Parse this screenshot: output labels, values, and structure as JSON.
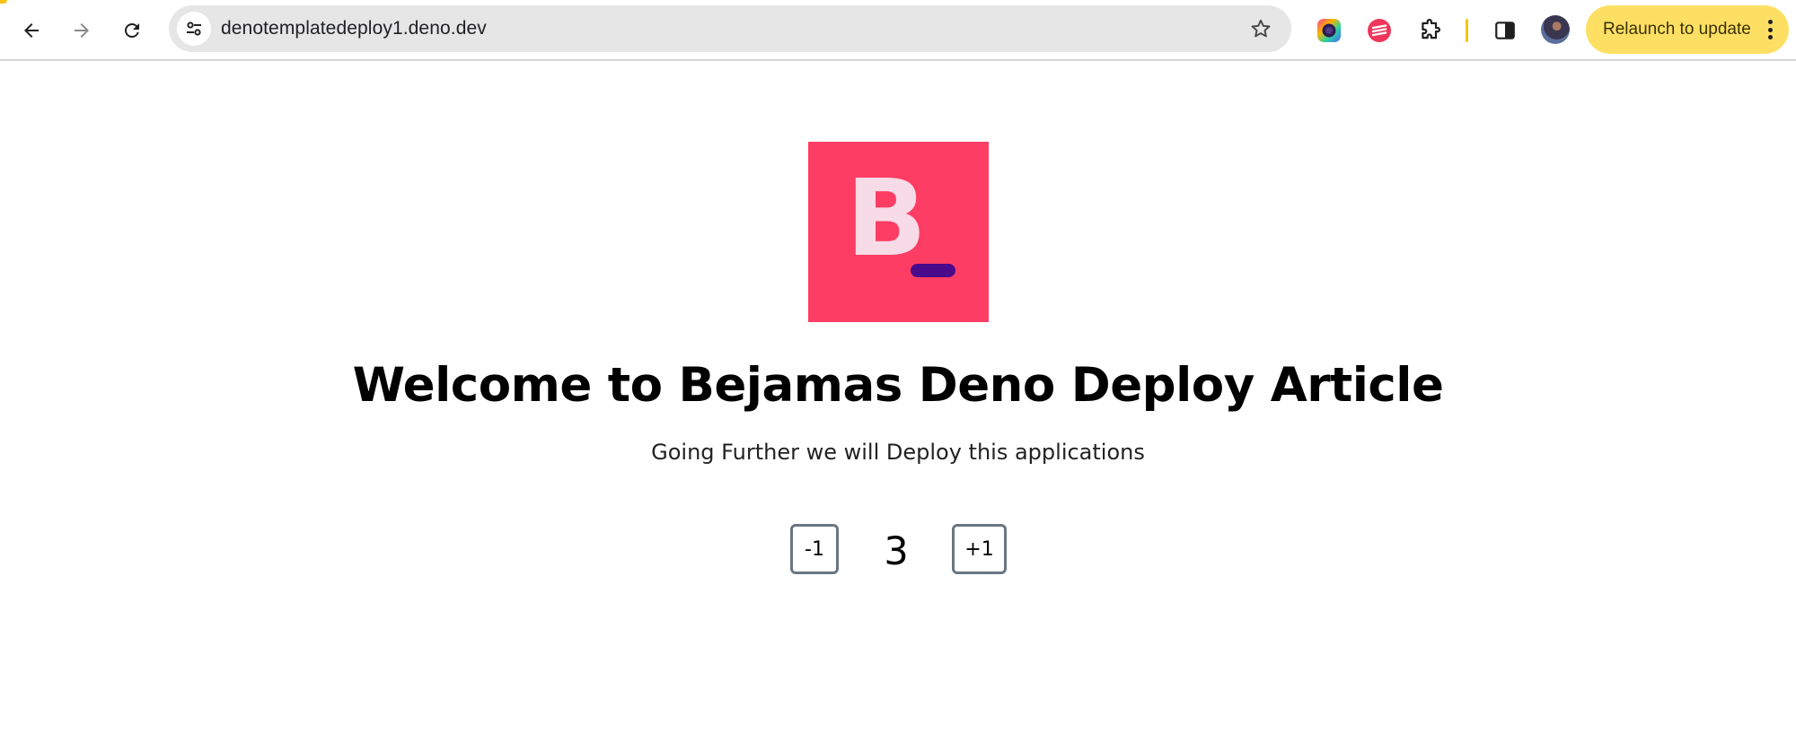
{
  "browser": {
    "url": "denotemplatedeploy1.deno.dev",
    "relaunch_label": "Relaunch to update",
    "icons": {
      "back": "arrow-left-icon",
      "forward": "arrow-right-icon",
      "reload": "reload-icon",
      "site_info": "tune-icon",
      "bookmark": "star-icon",
      "extension_1": "color-circle-extension-icon",
      "extension_2": "red-stripes-extension-icon",
      "extensions_menu": "puzzle-icon",
      "side_panel": "side-panel-icon",
      "menu": "kebab-menu-icon"
    },
    "accent_color": "#fde063"
  },
  "page": {
    "logo": {
      "letter": "B",
      "background_color": "#fe3d64",
      "bar_color": "#4a0a8c"
    },
    "title": "Welcome to Bejamas Deno Deploy Article",
    "subtitle": "Going Further we will Deploy this applications",
    "counter": {
      "decrement_label": "-1",
      "value": "3",
      "increment_label": "+1"
    }
  }
}
